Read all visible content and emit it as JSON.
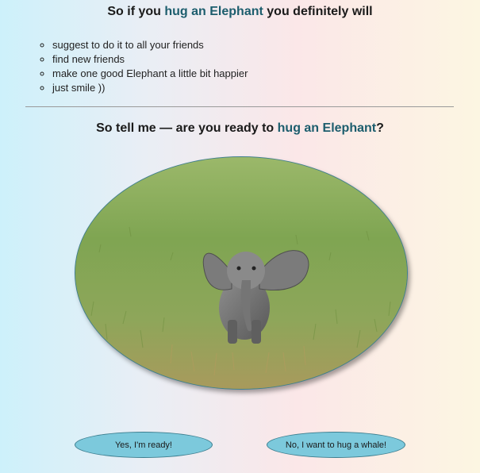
{
  "heading1": {
    "before": "So if you ",
    "highlight": "hug an Elephant",
    "after": " you definitely will"
  },
  "reasons": [
    "suggest to do it to all your friends",
    "find new friends",
    "make one good Elephant a little bit happier",
    "just smile ))"
  ],
  "heading2": {
    "before": "So tell me — are you ready to ",
    "highlight": "hug an Elephant",
    "after": "?"
  },
  "image": {
    "subject": "baby-elephant-in-grass"
  },
  "buttons": {
    "yes_label": "Yes, I'm ready!",
    "no_label": "No, I want to hug a whale!"
  },
  "colors": {
    "highlight_text": "#1c5d6d",
    "button_fill": "#7cc9dc",
    "button_border": "#3c7e8f"
  }
}
